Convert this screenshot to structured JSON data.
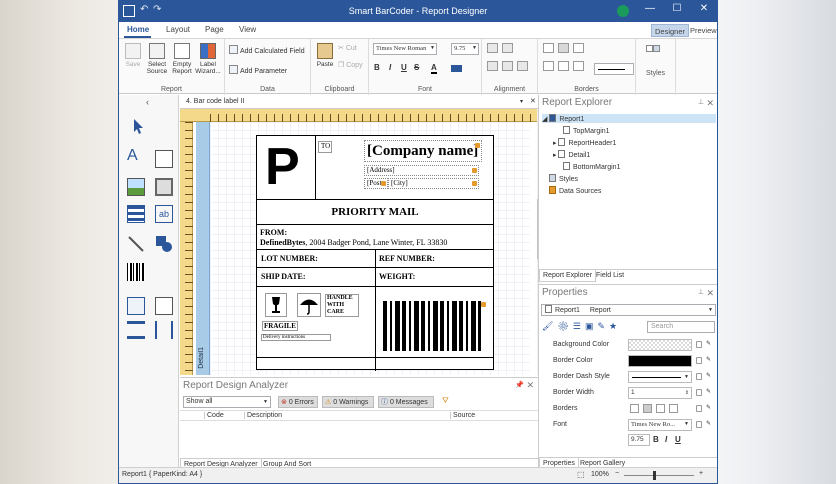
{
  "window": {
    "title": "Smart BarCoder - Report Designer",
    "controls": [
      "—",
      "☐",
      "✕"
    ]
  },
  "tabs": {
    "items": [
      "Home",
      "Layout",
      "Page",
      "View"
    ],
    "right": [
      "Designer",
      "Preview"
    ]
  },
  "ribbon": {
    "report": {
      "label": "Report",
      "save": "Save",
      "select_source": "Select Source",
      "empty_report": "Empty Report",
      "label_wizard": "Label Wizard..."
    },
    "data": {
      "label": "Data",
      "add_calculated_field": "Add Calculated Field",
      "add_parameter": "Add Parameter"
    },
    "clipboard": {
      "label": "Clipboard",
      "paste": "Paste",
      "cut": "Cut",
      "copy": "Copy"
    },
    "font": {
      "label": "Font",
      "family": "Times New Roman",
      "size": "9.75",
      "bold": "B",
      "italic": "I",
      "underline": "U",
      "strike": "S",
      "font_color": "A"
    },
    "alignment": {
      "label": "Alignment"
    },
    "borders": {
      "label": "Borders"
    },
    "styles": {
      "label": "Styles"
    }
  },
  "document_tab": {
    "label": "4. Bar code label II"
  },
  "label_design": {
    "big_letter": "P",
    "to": "TO",
    "company": "[Company name]",
    "address": "[Address]",
    "post": "[Post",
    "city": "[City]",
    "priority": "PRIORITY MAIL",
    "from_label": "FROM:",
    "from_company": "DefinedBytes",
    "from_address": ", 2004 Badger Pond, Lane Winter, FL 33830",
    "lot": "LOT NUMBER:",
    "ref": "REF NUMBER:",
    "ship_date": "SHIP DATE:",
    "weight": "WEIGHT:",
    "handle": "HANDLE WITH CARE",
    "fragile": "FRAGILE",
    "delivery": "Delivery instructions",
    "band": "Detail1"
  },
  "analyzer": {
    "title": "Report Design Analyzer",
    "filter": "Show all",
    "errors": "0 Errors",
    "warnings": "0 Warnings",
    "messages": "0 Messages",
    "columns": [
      "Code",
      "Description",
      "Source"
    ],
    "bottom_tabs": [
      "Report Design Analyzer",
      "Group And Sort"
    ]
  },
  "explorer": {
    "title": "Report Explorer",
    "tree": [
      "Report1",
      "TopMargin1",
      "ReportHeader1",
      "Detail1",
      "BottomMargin1",
      "Styles",
      "Data Sources"
    ],
    "bottom_tabs": [
      "Report Explorer",
      "Field List"
    ]
  },
  "properties": {
    "title": "Properties",
    "selected": "Report1",
    "selected_type": "Report",
    "search_placeholder": "Search",
    "rows": [
      {
        "name": "Background Color",
        "value": ""
      },
      {
        "name": "Border Color",
        "value": ""
      },
      {
        "name": "Border Dash Style",
        "value": ""
      },
      {
        "name": "Border Width",
        "value": "1"
      },
      {
        "name": "Borders",
        "value": ""
      },
      {
        "name": "Font",
        "value": "Times New Ro..."
      }
    ],
    "font_size": "9.75",
    "bottom_tabs": [
      "Properties",
      "Report Gallery"
    ]
  },
  "status": {
    "left": "Report1 { PaperKind: A4 }",
    "zoom": "100%"
  },
  "colors": {
    "accent": "#2b579a",
    "ruler": "#f5d98a",
    "band": "#a8cbe8",
    "lock": "#e39b2d"
  }
}
